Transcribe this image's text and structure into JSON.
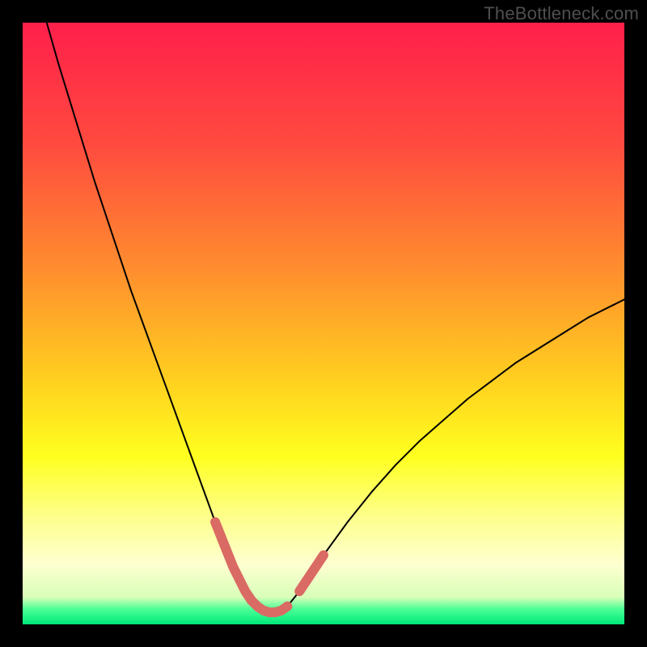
{
  "watermark": "TheBottleneck.com",
  "chart_data": {
    "type": "line",
    "title": "",
    "xlabel": "",
    "ylabel": "",
    "xlim": [
      0,
      100
    ],
    "ylim": [
      0,
      100
    ],
    "gradient_stops": [
      {
        "offset": 0.0,
        "color": "#ff1f4b"
      },
      {
        "offset": 0.2,
        "color": "#ff4a3f"
      },
      {
        "offset": 0.4,
        "color": "#ff8a2f"
      },
      {
        "offset": 0.6,
        "color": "#ffd21f"
      },
      {
        "offset": 0.72,
        "color": "#ffff1f"
      },
      {
        "offset": 0.82,
        "color": "#fdff8a"
      },
      {
        "offset": 0.9,
        "color": "#feffd0"
      },
      {
        "offset": 0.955,
        "color": "#d8ffb8"
      },
      {
        "offset": 0.975,
        "color": "#4aff96"
      },
      {
        "offset": 1.0,
        "color": "#00e87a"
      }
    ],
    "series": [
      {
        "name": "bottleneck-curve",
        "color": "#000000",
        "stroke_width": 2,
        "x": [
          4,
          6,
          8,
          10,
          12,
          14,
          16,
          18,
          20,
          22,
          24,
          26,
          28,
          30,
          32,
          33,
          34,
          35,
          36,
          37,
          38,
          39,
          40,
          41,
          42,
          43,
          44,
          46,
          48,
          50,
          54,
          58,
          62,
          66,
          70,
          74,
          78,
          82,
          86,
          90,
          94,
          98,
          100
        ],
        "y": [
          100,
          93,
          86.5,
          80,
          73.5,
          67.5,
          61.5,
          55.5,
          50,
          44.5,
          39,
          33.5,
          28,
          22.5,
          17,
          14.5,
          12,
          9.5,
          7.5,
          5.5,
          4,
          3,
          2.3,
          2,
          2,
          2.3,
          3,
          5.5,
          8.5,
          11.5,
          17,
          22,
          26.5,
          30.5,
          34,
          37.5,
          40.5,
          43.5,
          46,
          48.5,
          51,
          53,
          54
        ]
      },
      {
        "name": "highlight-left",
        "color": "#da6a64",
        "stroke_width": 12,
        "x": [
          32,
          33,
          34,
          35,
          36,
          37,
          38
        ],
        "y": [
          17,
          14.5,
          12,
          9.5,
          7.5,
          5.5,
          4
        ]
      },
      {
        "name": "highlight-bottom",
        "color": "#da6a64",
        "stroke_width": 12,
        "x": [
          38,
          39,
          40,
          41,
          42,
          43,
          44
        ],
        "y": [
          4,
          3,
          2.3,
          2,
          2,
          2.3,
          3
        ]
      },
      {
        "name": "highlight-right",
        "color": "#da6a64",
        "stroke_width": 12,
        "x": [
          46,
          48,
          50
        ],
        "y": [
          5.5,
          8.5,
          11.5
        ]
      }
    ]
  }
}
